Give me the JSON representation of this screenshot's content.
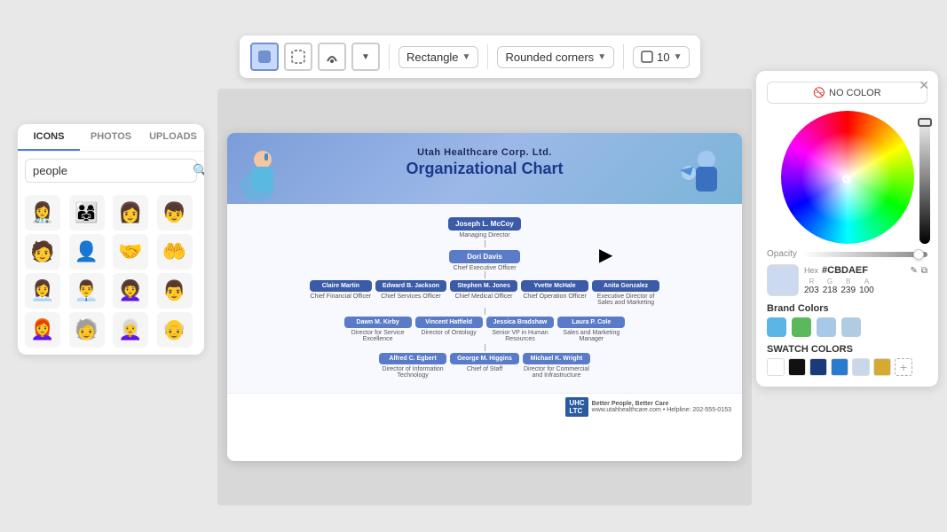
{
  "toolbar": {
    "shape_label": "Rectangle",
    "corners_label": "Rounded corners",
    "size_label": "10"
  },
  "left_panel": {
    "tabs": [
      "ICONS",
      "PHOTOS",
      "UPLOADS"
    ],
    "active_tab": "ICONS",
    "search_placeholder": "people",
    "icons": [
      "👩‍⚕️",
      "👨‍👩‍👧",
      "👩",
      "👦",
      "🧑",
      "👤",
      "🤝",
      "🤲",
      "👩‍💼",
      "👨‍💼",
      "👩‍🦱",
      "👨",
      "👩‍🦰",
      "🧓",
      "👩‍🦳",
      "👴"
    ]
  },
  "org_chart": {
    "company": "Utah Healthcare Corp. Ltd.",
    "title": "Organizational Chart",
    "nodes": {
      "ceo_title": "Joseph L. McCoy",
      "ceo_role": "Managing Director",
      "coo_title": "Dori Davis",
      "coo_role": "Chief Executive Officer",
      "level3": [
        {
          "name": "Claire Martin",
          "role": "Chief Financial Officer"
        },
        {
          "name": "Edward B. Jackson",
          "role": "Chief Services Officer"
        },
        {
          "name": "Stephen M. Jones",
          "role": "Chief Medical Officer"
        },
        {
          "name": "Yvette McHale",
          "role": "Chief Operation Officer"
        },
        {
          "name": "Anita Gonzalez",
          "role": "Executive Director of Sales and Marketing"
        }
      ],
      "level4": [
        {
          "name": "Dawn M. Kirby",
          "role": "Director for Service Excellence"
        },
        {
          "name": "Vincent Hatfield",
          "role": "Director of Ontology"
        },
        {
          "name": "Jessica Bradshaw",
          "role": "Senior VP in Human Resources"
        },
        {
          "name": "Laura P. Cole",
          "role": "Sales and Marketing Manager"
        }
      ],
      "level5": [
        {
          "name": "Alfred C. Egbert",
          "role": "Director of Information Technology"
        },
        {
          "name": "George M. Higgins",
          "role": "Chief of Staff"
        },
        {
          "name": "Michael K. Wright",
          "role": "Director for Commercial and Infrastructure"
        }
      ]
    },
    "footer_text": "Better People, Better Care",
    "footer_url": "www.utahhealthcare.com • Helpline: 202-555-0153"
  },
  "color_picker": {
    "no_color_label": "NO COLOR",
    "hex_label": "Hex",
    "hex_value": "#CBDAEF",
    "r": "203",
    "g": "218",
    "b": "239",
    "a": "100",
    "r_label": "R",
    "g_label": "G",
    "b_label": "B",
    "a_label": "A",
    "opacity_label": "Opacity",
    "brand_colors_label": "Brand Colors",
    "brand_colors": [
      "#5bb5e5",
      "#5cb85c",
      "#a8c8e8",
      "#b0cce0"
    ],
    "swatch_colors_label": "SWATCH COLORS",
    "swatch_colors": [
      "#ffffff",
      "#111111",
      "#1a3a7a",
      "#2a7ad0",
      "#c8d8ea",
      "#d4aa30"
    ]
  }
}
